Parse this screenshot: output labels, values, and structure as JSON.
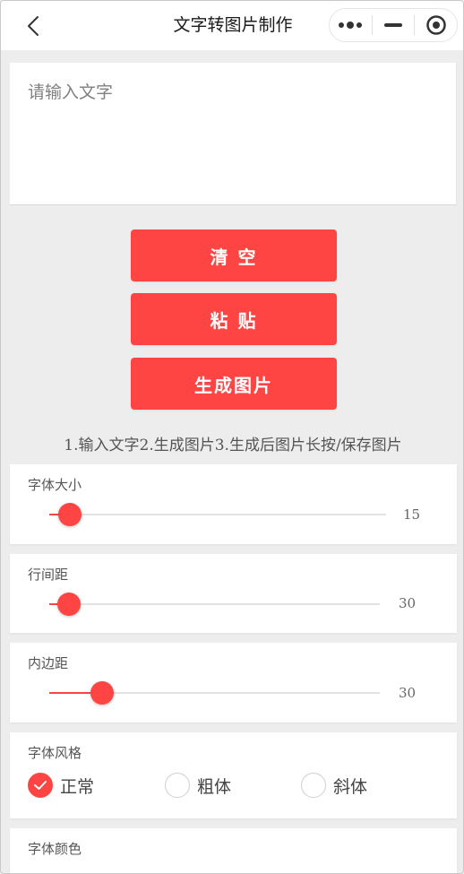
{
  "nav": {
    "title": "文字转图片制作"
  },
  "input": {
    "placeholder": "请输入文字",
    "value": ""
  },
  "buttons": {
    "clear": "清 空",
    "paste": "粘 贴",
    "generate": "生成图片"
  },
  "instructions": "1.输入文字2.生成图片3.生成后图片长按/保存图片",
  "settings": {
    "font_size": {
      "label": "字体大小",
      "value": "15",
      "fraction": 0.06
    },
    "line_spacing": {
      "label": "行间距",
      "value": "30",
      "fraction": 0.06
    },
    "padding": {
      "label": "内边距",
      "value": "30",
      "fraction": 0.16
    },
    "font_style": {
      "label": "字体风格",
      "options": [
        "正常",
        "粗体",
        "斜体"
      ],
      "selected": "正常"
    },
    "font_color": {
      "label": "字体颜色"
    }
  },
  "colors": {
    "accent": "#ff4444",
    "background": "#ededed",
    "card": "#ffffff"
  }
}
